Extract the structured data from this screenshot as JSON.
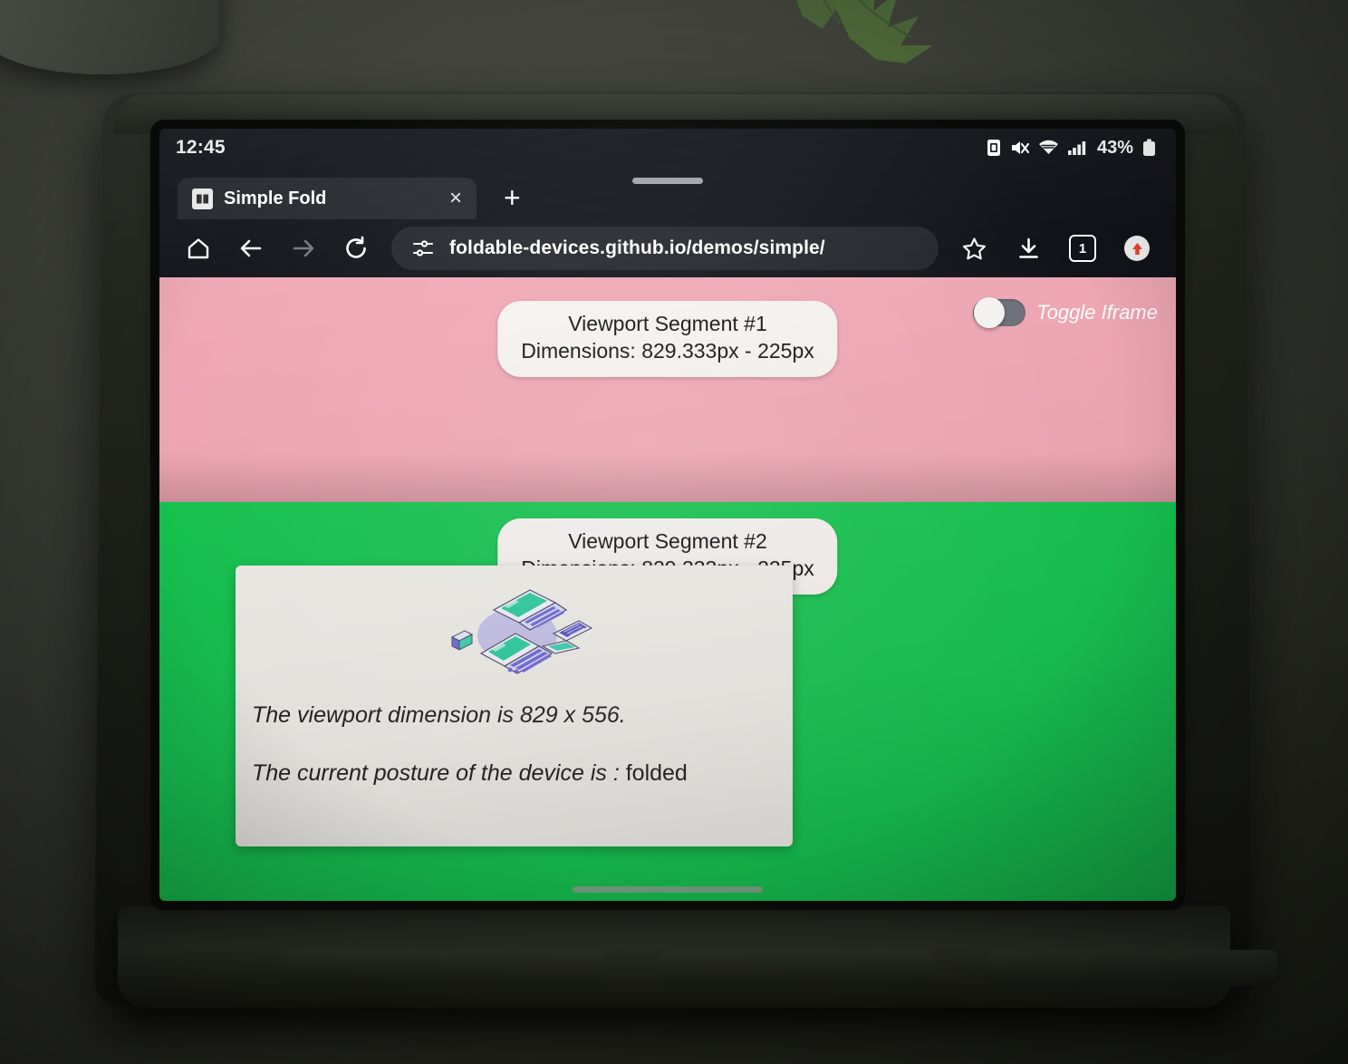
{
  "status_bar": {
    "clock": "12:45",
    "battery_percent": "43%",
    "icons": [
      "screenshot-icon",
      "mute-icon",
      "wifi-icon",
      "signal-icon",
      "battery-icon"
    ]
  },
  "browser": {
    "tab": {
      "title": "Simple Fold",
      "favicon": "simple-fold-favicon",
      "close_label": "×"
    },
    "new_tab_label": "+",
    "nav": {
      "home": "home-icon",
      "back": "back-arrow-icon",
      "forward": "forward-arrow-icon",
      "reload": "reload-icon"
    },
    "omnibox": {
      "site_settings_icon": "tune-icon",
      "url": "foldable-devices.github.io/demos/simple/"
    },
    "actions": {
      "bookmark": "star-icon",
      "download": "download-icon",
      "tab_count": "1",
      "profile": "profile-icon"
    }
  },
  "page": {
    "segment1": {
      "title": "Viewport Segment #1",
      "dimensions": "Dimensions: 829.333px - 225px",
      "color": "#efa7b4"
    },
    "segment2": {
      "title": "Viewport Segment #2",
      "dimensions": "Dimensions: 829.333px - 225px",
      "color": "#17c451"
    },
    "toggle": {
      "label": "Toggle Iframe",
      "state": "off"
    },
    "card": {
      "illustration": "foldable-devices-illustration",
      "viewport_line": "The viewport dimension is 829 x 556.",
      "posture_prefix": "The current posture of the device is : ",
      "posture_value": "folded"
    }
  }
}
